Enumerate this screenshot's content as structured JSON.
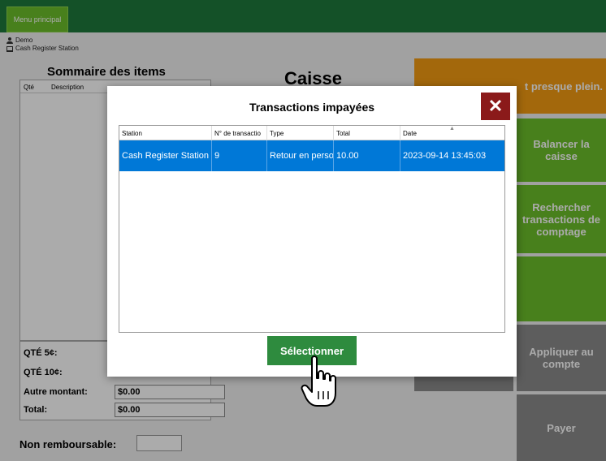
{
  "topbar": {
    "menu_label": "Menu principal"
  },
  "user": {
    "name": "Demo",
    "station": "Cash Register Station"
  },
  "summary": {
    "title": "Sommaire des items",
    "columns": [
      "Qté",
      "Description"
    ]
  },
  "caisse_title": "Caisse",
  "totals": {
    "qte5_label": "QTÉ 5¢:",
    "qte10_label": "QTÉ 10¢:",
    "autre_label": "Autre montant:",
    "autre_value": "$0.00",
    "total_label": "Total:",
    "total_value": "$0.00"
  },
  "non_remboursable_label": "Non remboursable:",
  "tiles": {
    "orange_partial": "t presque plein.",
    "balancer": "Balancer la caisse",
    "rechercher": "Rechercher transactions de comptage",
    "appliquer": "Appliquer au compte",
    "payer": "Payer"
  },
  "modal": {
    "title": "Transactions impayées",
    "close_glyph": "✕",
    "columns": [
      "Station",
      "N° de transactio",
      "Type",
      "Total",
      "Date"
    ],
    "rows": [
      {
        "station": "Cash Register Station",
        "number": "9",
        "type": "Retour en perso",
        "total": "10.00",
        "date": "2023-09-14 13:45:03"
      }
    ],
    "select_label": "Sélectionner"
  },
  "colors": {
    "topbar": "#1e7a3c",
    "accent_green": "#6cbf2a",
    "orange": "#f39c12",
    "gray_tile": "#8b8b8b",
    "close_red": "#8b1a1a",
    "select_green": "#2e8b3e",
    "row_selected": "#0078d7"
  }
}
